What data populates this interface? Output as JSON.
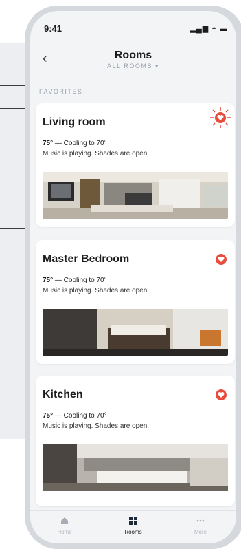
{
  "status": {
    "time": "9:41",
    "icons": "▂▄▆ ◓ ▬"
  },
  "header": {
    "back": "‹",
    "title": "Rooms",
    "subtitle": "ALL ROOMS ▾"
  },
  "section_label": "FAVORITES",
  "rooms": [
    {
      "name": "Living room",
      "temp": "75°",
      "status": "— Cooling to 70°",
      "desc": "Music is playing. Shades are open.",
      "favorite": true
    },
    {
      "name": "Master Bedroom",
      "temp": "75°",
      "status": "— Cooling to 70°",
      "desc": "Music is playing. Shades are open.",
      "favorite": true
    },
    {
      "name": "Kitchen",
      "temp": "75°",
      "status": "— Cooling to 70°",
      "desc": "Music is playing. Shades are open.",
      "favorite": true
    }
  ],
  "tabs": [
    {
      "label": "Home",
      "icon": "home-icon"
    },
    {
      "label": "Rooms",
      "icon": "rooms-grid-icon"
    },
    {
      "label": "More",
      "icon": "more-icon"
    }
  ],
  "colors": {
    "accent": "#e74c3c",
    "background": "#f3f4f6",
    "card": "#ffffff"
  }
}
